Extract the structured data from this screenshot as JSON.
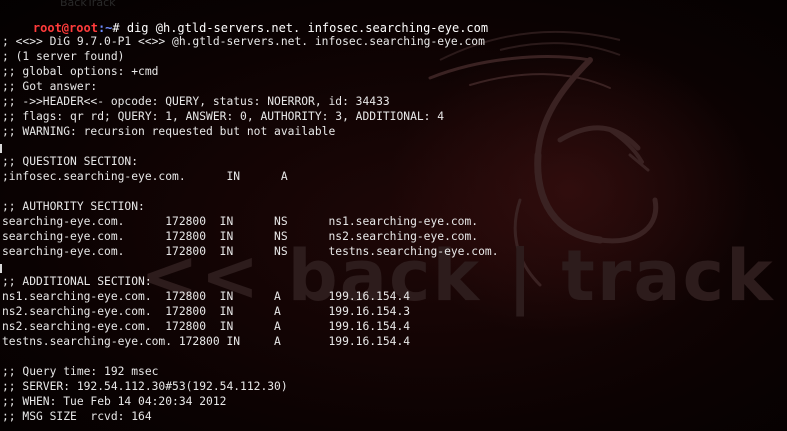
{
  "wallpaper": {
    "brand_text": "<< back | track 5",
    "top_fragment": "BackTrack",
    "accent_color": "#6e1414"
  },
  "prompt": {
    "user": "root@root",
    "path": ":~",
    "symbol": "#",
    "command": "dig @h.gtld-servers.net. infosec.searching-eye.com"
  },
  "output_lines": [
    "; <<>> DiG 9.7.0-P1 <<>> @h.gtld-servers.net. infosec.searching-eye.com",
    "; (1 server found)",
    ";; global options: +cmd",
    ";; Got answer:",
    ";; ->>HEADER<<- opcode: QUERY, status: NOERROR, id: 34433",
    ";; flags: qr rd; QUERY: 1, ANSWER: 0, AUTHORITY: 3, ADDITIONAL: 4",
    ";; WARNING: recursion requested but not available",
    "",
    ";; QUESTION SECTION:",
    ";infosec.searching-eye.com.      IN      A",
    "",
    ";; AUTHORITY SECTION:",
    "searching-eye.com.      172800  IN      NS      ns1.searching-eye.com.",
    "searching-eye.com.      172800  IN      NS      ns2.searching-eye.com.",
    "searching-eye.com.      172800  IN      NS      testns.searching-eye.com.",
    "",
    ";; ADDITIONAL SECTION:",
    "ns1.searching-eye.com.  172800  IN      A       199.16.154.4",
    "ns2.searching-eye.com.  172800  IN      A       199.16.154.3",
    "ns2.searching-eye.com.  172800  IN      A       199.16.154.4",
    "testns.searching-eye.com. 172800 IN     A       199.16.154.4",
    "",
    ";; Query time: 192 msec",
    ";; SERVER: 192.54.112.30#53(192.54.112.30)",
    ";; WHEN: Tue Feb 14 04:20:34 2012",
    ";; MSG SIZE  rcvd: 164"
  ]
}
